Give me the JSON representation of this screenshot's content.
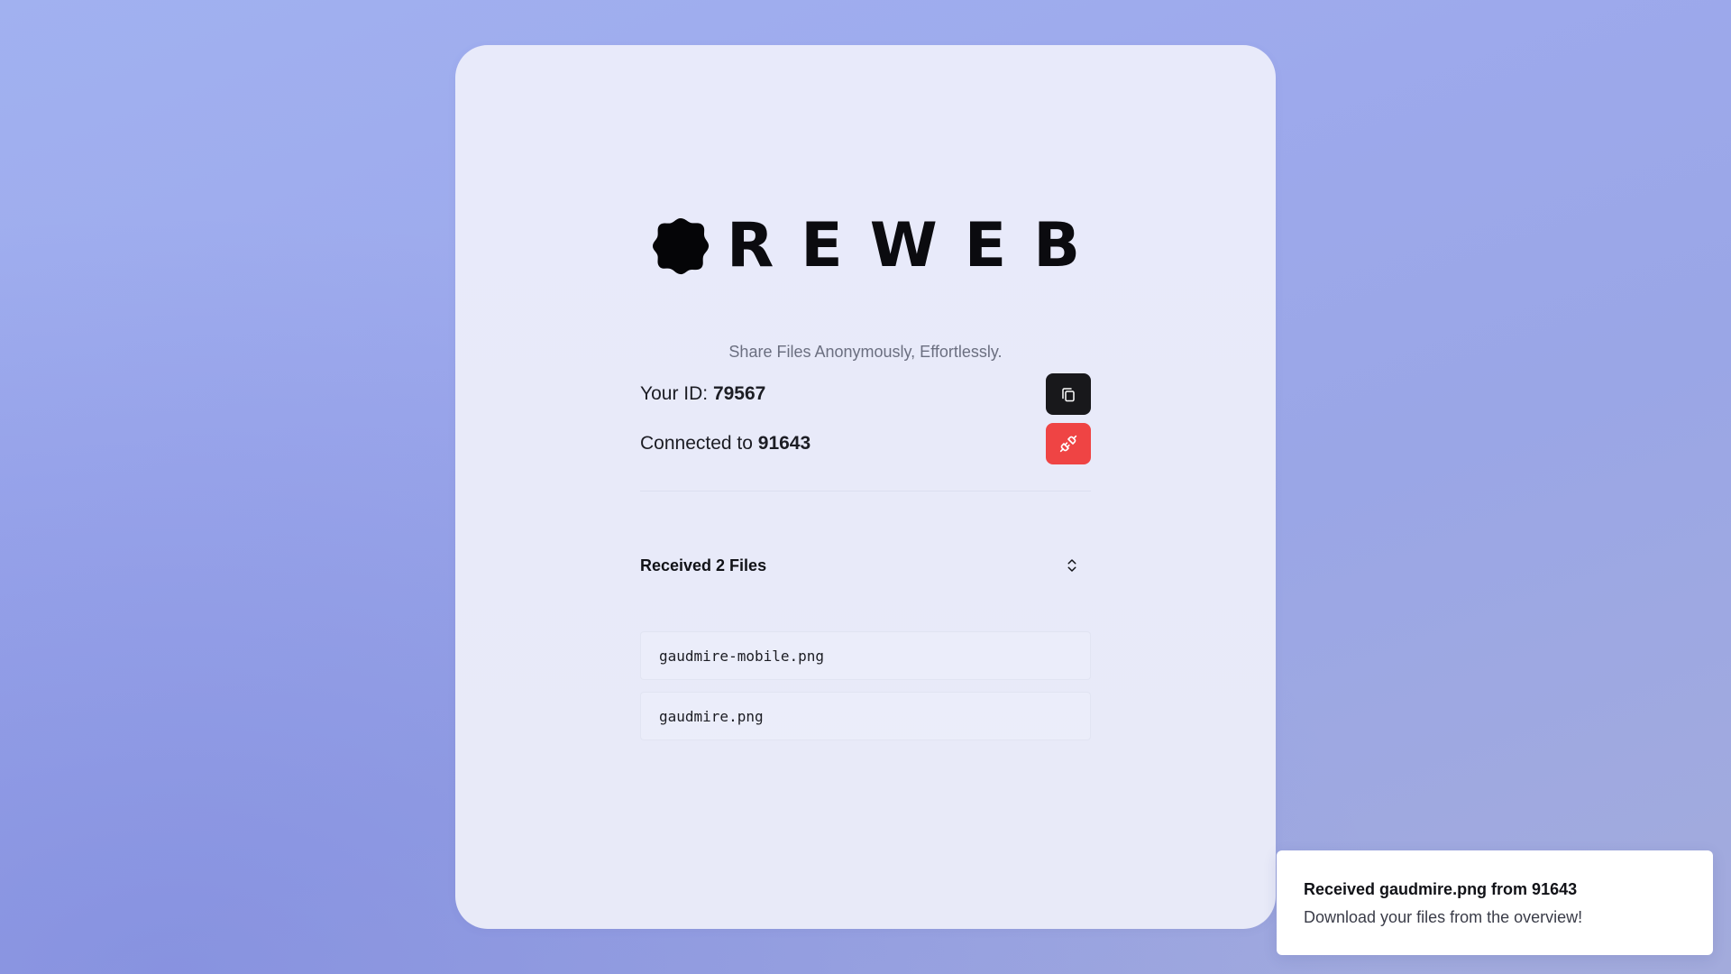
{
  "brand": {
    "name": "REWEB",
    "tagline": "Share Files Anonymously, Effortlessly.",
    "logo_icon": "blob-badge-icon"
  },
  "connection": {
    "id_prefix": "Your ID: ",
    "id_value": "79567",
    "connected_prefix": "Connected to ",
    "connected_value": "91643",
    "copy_icon": "copy-icon",
    "disconnect_icon": "unplug-icon",
    "disconnect_color": "#ef4444"
  },
  "files": {
    "title": "Received 2 Files",
    "toggle_icon": "chevrons-up-down-icon",
    "items": [
      "gaudmire-mobile.png",
      "gaudmire.png"
    ]
  },
  "toast": {
    "title": "Received gaudmire.png from 91643",
    "description": "Download your files from the overview!"
  }
}
